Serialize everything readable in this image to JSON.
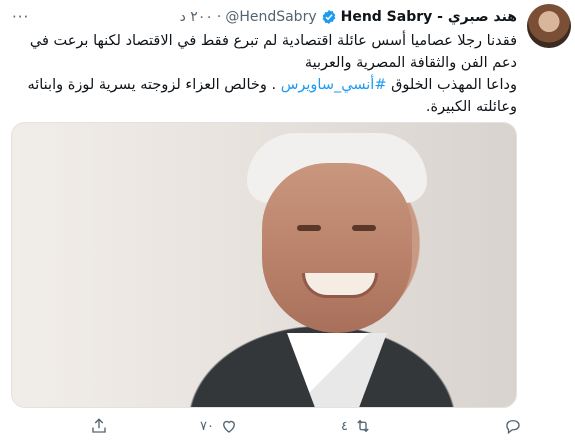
{
  "tweet": {
    "author_name": "Hend Sabry - هند صبري",
    "handle": "@HendSabry",
    "separator": "·",
    "time": "٢٠٠ د",
    "more_label": "···",
    "text_line_1": "فقدنا رجلا عصاميا أسس عائلة اقتصادية لم تبرع فقط في الاقتصاد لكنها برعت في دعم الفن والثقافة المصرية والعربية",
    "text_line_2_pre": "وداعا المهذب الخلوق ",
    "hashtag": "#أنسي_ساويرس",
    "text_line_2_post": " . وخالص العزاء لزوجته يسرية لوزة وابنائه وعائلته الكبيرة."
  },
  "actions": {
    "reply_count": "",
    "retweet_count": "٤",
    "like_count": "٧٠",
    "share_count": ""
  },
  "icons": [
    "avatar",
    "verified-icon",
    "reply-icon",
    "retweet-icon",
    "like-icon",
    "share-icon",
    "more-icon"
  ],
  "colors": {
    "accent": "#1d9bf0",
    "muted": "#536471",
    "text": "#0f1419"
  }
}
